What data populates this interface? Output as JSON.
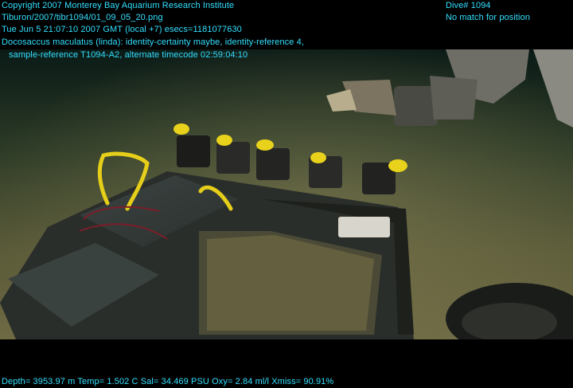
{
  "overlay": {
    "copyright": "Copyright 2007 Monterey Bay Aquarium Research Institute",
    "image_path": "Tiburon/2007/tibr1094/01_09_05_20.png",
    "datetime": "Tue Jun  5 21:07:10 2007 GMT (local +7)  esecs=1181077630",
    "annotation_line1": "Docosaccus maculatus (linda): identity-certainty maybe, identity-reference 4,",
    "annotation_line2": "sample-reference T1094-A2, alternate timecode 02:59:04:10",
    "dive": "Dive# 1094",
    "position_status": "No match for position",
    "sensors": "Depth= 3953.97 m  Temp= 1.502 C  Sal= 34.469 PSU  Oxy= 2.84 ml/l  Xmiss= 90.91%"
  }
}
